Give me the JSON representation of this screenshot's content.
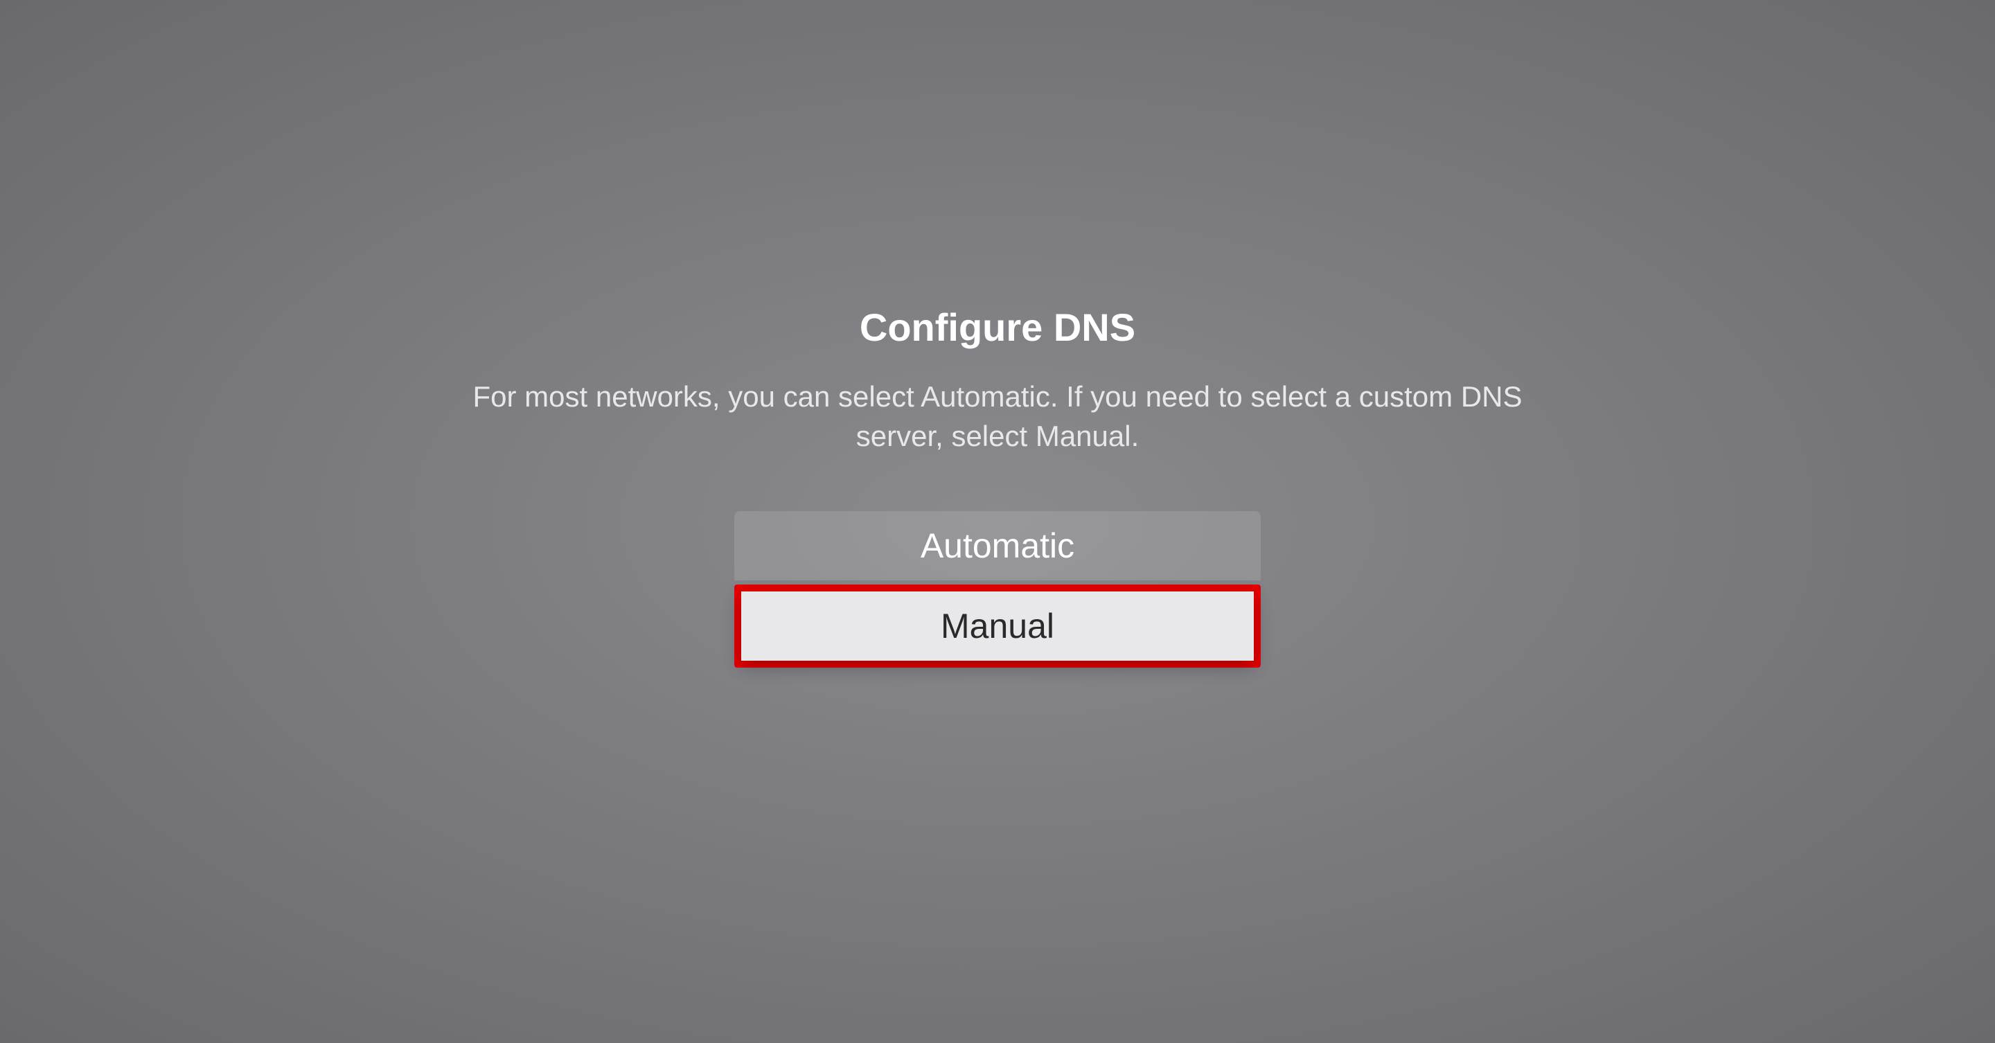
{
  "title": "Configure DNS",
  "description": "For most networks, you can select Automatic. If you need to select a custom DNS server, select Manual.",
  "options": {
    "automatic_label": "Automatic",
    "manual_label": "Manual"
  },
  "highlight_color": "#e60000",
  "selected_option": "manual"
}
